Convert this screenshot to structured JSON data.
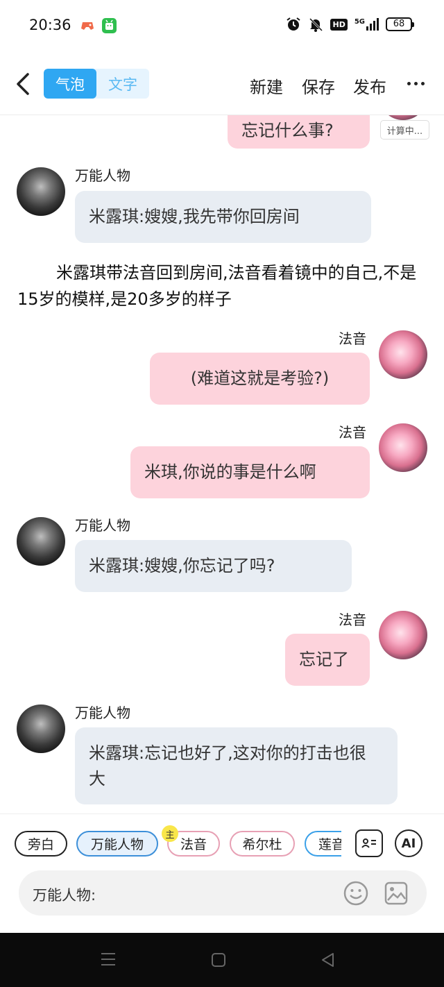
{
  "status_bar": {
    "time": "20:36",
    "network": "5G",
    "hd": "HD",
    "battery": "68",
    "icons": [
      "game-app-icon",
      "android-app-icon",
      "alarm-icon",
      "mute-icon",
      "signal-icon",
      "battery-icon"
    ]
  },
  "header": {
    "back_icon": "chevron-left-icon",
    "mode_tabs": [
      {
        "label": "气泡",
        "active": true
      },
      {
        "label": "文字",
        "active": false
      }
    ],
    "actions": {
      "new": "新建",
      "save": "保存",
      "publish": "发布"
    },
    "more_icon": "more-dots-icon",
    "accent": "#2fa7f2"
  },
  "chat": {
    "messages": [
      {
        "side": "right",
        "text": "忘记什么事?",
        "status": "计算中..."
      },
      {
        "side": "left",
        "speaker": "万能人物",
        "text": "米露琪:嫂嫂,我先带你回房间"
      },
      {
        "type": "narration",
        "text": "米露琪带法音回到房间,法音看着镜中的自己,不是15岁的模样,是20多岁的样子"
      },
      {
        "side": "right",
        "speaker": "法音",
        "text": "(难道这就是考验?)"
      },
      {
        "side": "right",
        "speaker": "法音",
        "text": "米琪,你说的事是什么啊"
      },
      {
        "side": "left",
        "speaker": "万能人物",
        "text": "米露琪:嫂嫂,你忘记了吗?"
      },
      {
        "side": "right",
        "speaker": "法音",
        "text": "忘记了"
      },
      {
        "side": "left",
        "speaker": "万能人物",
        "text": "米露琪:忘记也好了,这对你的打击也很大"
      }
    ],
    "colors": {
      "left_bubble": "#e8edf3",
      "right_bubble": "#fdd3dc"
    }
  },
  "composer": {
    "roles": [
      "旁白",
      "万能人物",
      "法音",
      "希尔杜",
      "莲音"
    ],
    "selected_role": "万能人物",
    "main_badge": "主",
    "buttons": {
      "role_card_icon": "contact-card-icon",
      "ai_label": "AI"
    },
    "input_prefix": "万能人物:",
    "emoji_icon": "smile-icon",
    "image_icon": "image-icon"
  },
  "nav_bar": {
    "icons": [
      "menu-icon",
      "home-icon",
      "back-triangle-icon"
    ]
  }
}
